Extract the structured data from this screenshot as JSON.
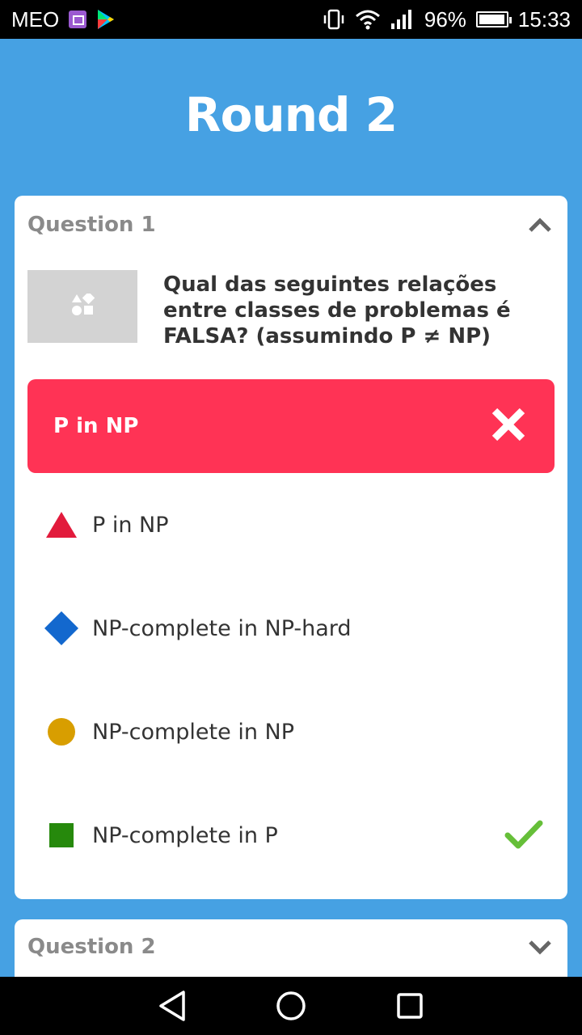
{
  "status_bar": {
    "carrier": "MEO",
    "battery": "96%",
    "battery_level": 0.96,
    "time": "15:33",
    "icons": [
      "gallery-icon",
      "play-store-icon",
      "vibrate-icon",
      "wifi-icon",
      "signal-icon",
      "battery-icon"
    ]
  },
  "title": "Round 2",
  "question1": {
    "label": "Question 1",
    "expanded": true,
    "image_icon": "shapes-placeholder-icon",
    "text": "Qual das seguintes relações entre classes de problemas é FALSA? (assumindo P ≠ NP)",
    "chosen_answer": {
      "label": "P in NP",
      "icon": "x-icon",
      "color": "#ff3355"
    },
    "options": [
      {
        "label": "P in NP",
        "shape": "triangle",
        "color": "#e21b3c",
        "correct": false
      },
      {
        "label": "NP-complete in NP-hard",
        "shape": "diamond",
        "color": "#1368ce",
        "correct": false
      },
      {
        "label": "NP-complete in NP",
        "shape": "circle",
        "color": "#d89e00",
        "correct": false
      },
      {
        "label": "NP-complete in P",
        "shape": "square",
        "color": "#26890c",
        "correct": true
      }
    ],
    "check_color": "#66bf39"
  },
  "question2": {
    "label": "Question 2",
    "expanded": false
  },
  "colors": {
    "background": "#46a1e3",
    "card": "#ffffff"
  }
}
